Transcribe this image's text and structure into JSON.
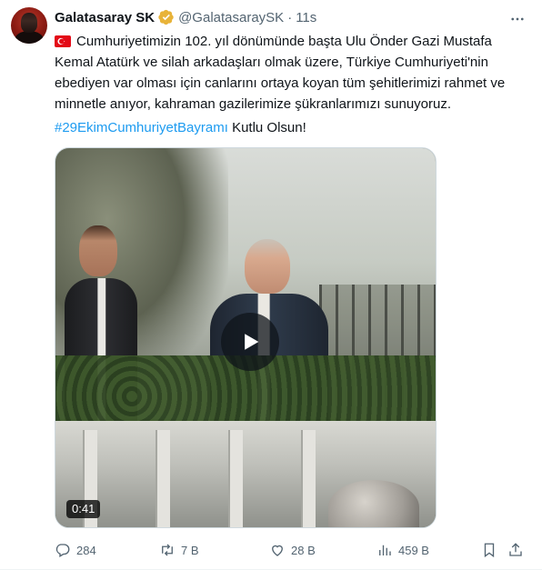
{
  "account": {
    "display_name": "Galatasaray SK",
    "handle": "@GalatasaraySK",
    "separator": "·",
    "time": "11s",
    "verified_badge_color": "#e8b339"
  },
  "tweet": {
    "flag_icon": "turkey-flag-icon",
    "body": "Cumhuriyetimizin 102. yıl dönümünde başta Ulu Önder Gazi Mustafa Kemal Atatürk ve silah arkadaşları olmak üzere, Türkiye Cumhuriyeti'nin ebediyen var olması için canlarını ortaya koyan tüm şehitlerimizi rahmet ve minnetle anıyor, kahraman gazilerimize şükranlarımızı sunuyoruz.",
    "hashtag": "#29EkimCumhuriyetBayramı",
    "hashtag_suffix": " Kutlu Olsun!",
    "link_color": "#1d9bf0"
  },
  "media": {
    "type": "video",
    "duration": "0:41",
    "play_icon": "play-icon"
  },
  "actions": {
    "replies": "284",
    "reposts": "7 B",
    "likes": "28 B",
    "views": "459 B",
    "bookmark_icon": "bookmark-icon",
    "share_icon": "share-icon"
  }
}
